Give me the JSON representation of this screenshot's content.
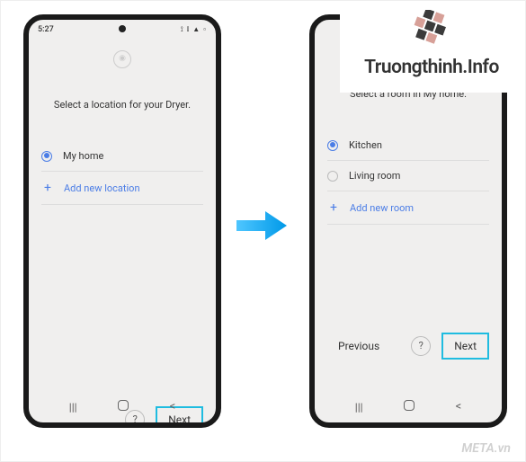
{
  "status": {
    "time": "5:27",
    "left_icons": "◎ ☁ ⚙",
    "right_icons": "⟟ ⫾ ▲ ▫"
  },
  "left": {
    "title": "Select a location for your Dryer.",
    "option1": "My home",
    "add": "Add new location",
    "help": "?",
    "next": "Next"
  },
  "right": {
    "title": "Select a room in My home.",
    "option1": "Kitchen",
    "option2": "Living room",
    "add": "Add new room",
    "help": "?",
    "prev": "Previous",
    "next": "Next"
  },
  "brand": "Truongthinh.Info",
  "watermark": "META.vn"
}
